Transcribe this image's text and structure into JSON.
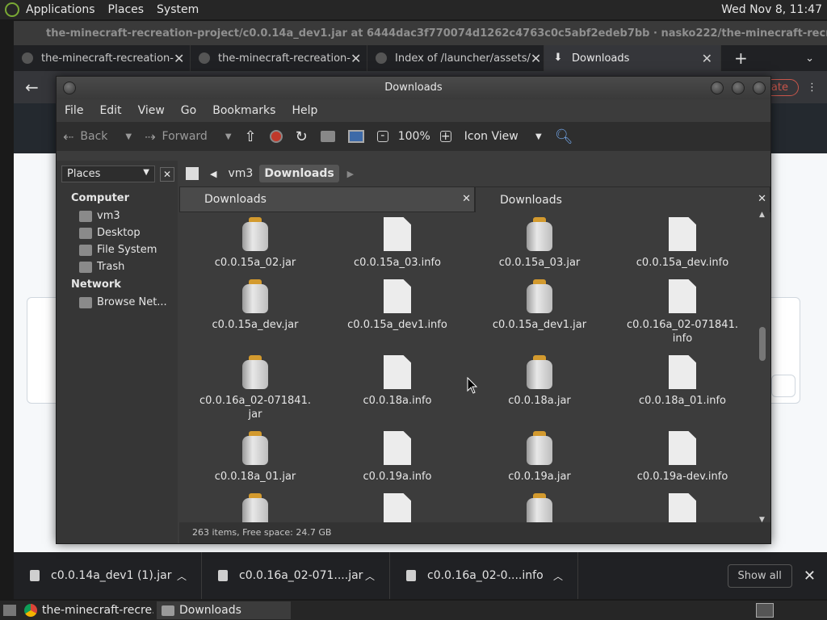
{
  "top_panel": {
    "menus": [
      "Applications",
      "Places",
      "System"
    ],
    "clock": "Wed Nov 8, 11:47"
  },
  "browser": {
    "title": "the-minecraft-recreation-project/c0.0.14a_dev1.jar at 6444dac3f770074d1262c4763c0c5abf2edeb7bb · nasko222/the-minecraft-recreation-pr...",
    "tabs": [
      {
        "label": "the-minecraft-recreation-",
        "icon": "github-icon"
      },
      {
        "label": "the-minecraft-recreation-",
        "icon": "github-icon"
      },
      {
        "label": "Index of /launcher/assets/",
        "icon": "globe-icon"
      },
      {
        "label": "Downloads",
        "icon": "download-icon"
      }
    ],
    "update_label": "odate"
  },
  "downloads_bar": {
    "items": [
      {
        "name": "c0.0.14a_dev1 (1).jar"
      },
      {
        "name": "c0.0.16a_02-071....jar"
      },
      {
        "name": "c0.0.16a_02-0....info"
      }
    ],
    "show_all": "Show all"
  },
  "taskbar": {
    "tasks": [
      "the-minecraft-recre...",
      "Downloads"
    ]
  },
  "file_manager": {
    "title": "Downloads",
    "menus": [
      "File",
      "Edit",
      "View",
      "Go",
      "Bookmarks",
      "Help"
    ],
    "toolbar": {
      "back": "Back",
      "forward": "Forward",
      "zoom": "100%",
      "view_mode": "Icon View"
    },
    "sidebar": {
      "selector": "Places",
      "computer_heading": "Computer",
      "computer_items": [
        "vm3",
        "Desktop",
        "File System",
        "Trash"
      ],
      "network_heading": "Network",
      "network_items": [
        "Browse Net..."
      ]
    },
    "path": [
      "vm3",
      "Downloads"
    ],
    "panes": [
      "Downloads",
      "Downloads"
    ],
    "files": [
      {
        "name": "c0.0.15a_02.jar",
        "type": "jar"
      },
      {
        "name": "c0.0.15a_03.info",
        "type": "info"
      },
      {
        "name": "c0.0.15a_03.jar",
        "type": "jar"
      },
      {
        "name": "c0.0.15a_dev.info",
        "type": "info"
      },
      {
        "name": "c0.0.15a_dev.jar",
        "type": "jar"
      },
      {
        "name": "c0.0.15a_dev1.info",
        "type": "info"
      },
      {
        "name": "c0.0.15a_dev1.jar",
        "type": "jar"
      },
      {
        "name": "c0.0.16a_02-071841.\ninfo",
        "type": "info"
      },
      {
        "name": "c0.0.16a_02-071841.\njar",
        "type": "jar"
      },
      {
        "name": "c0.0.18a.info",
        "type": "info"
      },
      {
        "name": "c0.0.18a.jar",
        "type": "jar"
      },
      {
        "name": "c0.0.18a_01.info",
        "type": "info"
      },
      {
        "name": "c0.0.18a_01.jar",
        "type": "jar"
      },
      {
        "name": "c0.0.19a.info",
        "type": "info"
      },
      {
        "name": "c0.0.19a.jar",
        "type": "jar"
      },
      {
        "name": "c0.0.19a-dev.info",
        "type": "info"
      },
      {
        "name": "",
        "type": "jar"
      },
      {
        "name": "",
        "type": "info"
      },
      {
        "name": "",
        "type": "jar"
      },
      {
        "name": "",
        "type": "info"
      }
    ],
    "status": "263 items, Free space: 24.7 GB"
  }
}
